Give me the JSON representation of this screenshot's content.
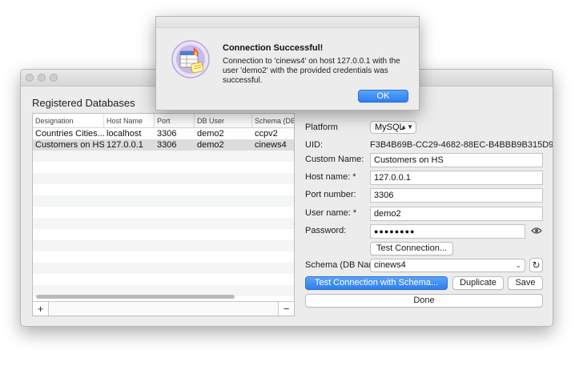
{
  "window": {
    "section_title": "Registered Databases"
  },
  "table": {
    "columns": [
      "Designation",
      "Host Name",
      "Port",
      "DB User",
      "Schema (DB"
    ],
    "rows": [
      {
        "designation": "Countries Cities...",
        "host": "localhost",
        "port": "3306",
        "user": "demo2",
        "schema": "ccpv2"
      },
      {
        "designation": "Customers on HS",
        "host": "127.0.0.1",
        "port": "3306",
        "user": "demo2",
        "schema": "cinews4"
      }
    ],
    "selected_row": 1,
    "add_label": "+",
    "remove_label": "−"
  },
  "form": {
    "platform_label": "Platform",
    "platform_value": "MySQL",
    "uid_label": "UID:",
    "uid_value": "F3B4B69B-CC29-4682-88EC-B4BBB9B315D9",
    "custom_name_label": "Custom Name:",
    "custom_name_value": "Customers on HS",
    "host_label": "Host name: *",
    "host_value": "127.0.0.1",
    "port_label": "Port number:",
    "port_value": "3306",
    "user_label": "User name: *",
    "user_value": "demo2",
    "password_label": "Password:",
    "password_value": "●●●●●●●●",
    "test_connection_label": "Test Connection...",
    "schema_label": "Schema (DB Nam",
    "schema_value": "cinews4",
    "test_with_schema_label": "Test Connection with Schema...",
    "duplicate_label": "Duplicate",
    "save_label": "Save",
    "done_label": "Done"
  },
  "dialog": {
    "title": "Connection Successful!",
    "message": "Connection to 'cinews4' on host 127.0.0.1 with the user 'demo2' with the provided credentials was successful.",
    "ok_label": "OK"
  },
  "colors": {
    "accent": "#2f7df0",
    "window_bg": "#ececec"
  }
}
